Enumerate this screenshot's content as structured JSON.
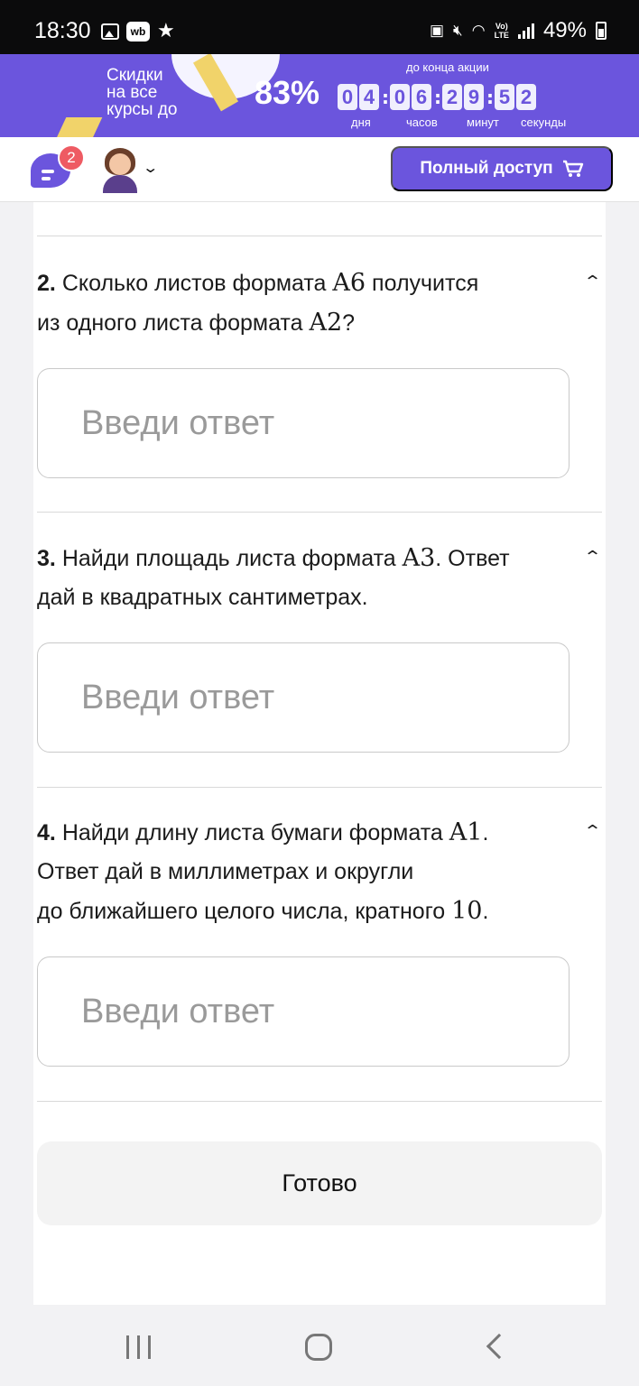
{
  "status_bar": {
    "time": "18:30",
    "wb_label": "wb",
    "lte": "Vo)\nLTE",
    "battery": "49%"
  },
  "promo": {
    "text": "Скидки\nна все\nкурсы до",
    "percent": "83%",
    "until_label": "до конца акции",
    "timer_digits": [
      "0",
      "4",
      "0",
      "6",
      "2",
      "9",
      "5",
      "2"
    ],
    "timer_units": [
      "дня",
      "часов",
      "минут",
      "секунды"
    ],
    "accent_color": "#6b55dd",
    "ribbon_color": "#f1d36a"
  },
  "header": {
    "chat_badge": "2",
    "full_access_label": "Полный доступ",
    "icons": [
      "chat-icon",
      "avatar",
      "chevron-down-icon",
      "cart-icon"
    ]
  },
  "questions": [
    {
      "num": "2.",
      "line1_pre": "Сколько листов формата ",
      "line1_math": "A6",
      "line1_post": " получится",
      "line2_pre": "из одного листа формата ",
      "line2_math": "A2",
      "line2_post": "?",
      "placeholder": "Введи ответ"
    },
    {
      "num": "3.",
      "line1_pre": "Найди площадь листа формата ",
      "line1_math": "A3",
      "line1_post": ". Ответ",
      "line2": "дай в квадратных сантиметрах.",
      "placeholder": "Введи ответ"
    },
    {
      "num": "4.",
      "line1_pre": "Найди длину листа бумаги формата ",
      "line1_math": "A1",
      "line1_post": ".",
      "line2": "Ответ дай в миллиметрах и округли",
      "line3_pre": "до ближайшего целого числа, кратного ",
      "line3_math": "10",
      "line3_post": ".",
      "placeholder": "Введи ответ"
    }
  ],
  "done_label": "Готово"
}
